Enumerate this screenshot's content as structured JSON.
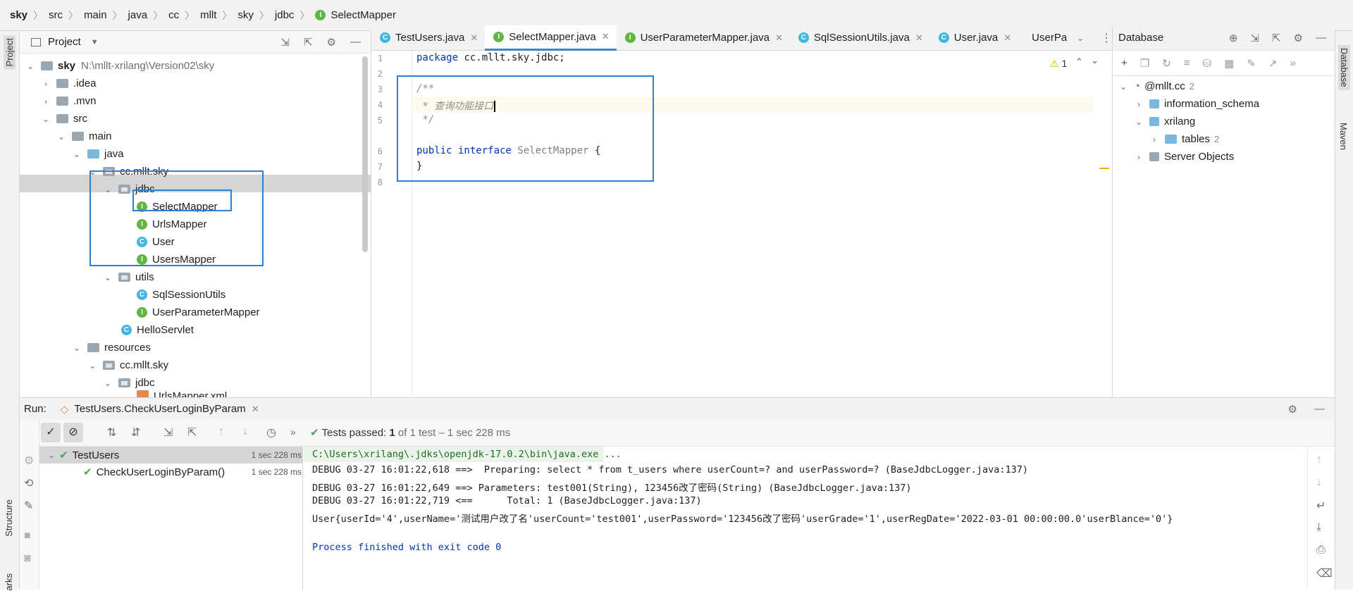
{
  "breadcrumb": [
    "sky",
    "src",
    "main",
    "java",
    "cc",
    "mllt",
    "sky",
    "jdbc",
    "SelectMapper"
  ],
  "project": {
    "title": "Project",
    "root": {
      "name": "sky",
      "path": "N:\\mllt-xrilang\\Version02\\sky"
    },
    "items": [
      ".idea",
      ".mvn",
      "src",
      "main",
      "java",
      "cc.mllt.sky",
      "jdbc",
      "SelectMapper",
      "UrlsMapper",
      "User",
      "UsersMapper",
      "utils",
      "SqlSessionUtils",
      "UserParameterMapper",
      "HelloServlet",
      "resources",
      "cc.mllt.sky",
      "jdbc",
      "UrlsMapper.xml"
    ]
  },
  "editor": {
    "tabs": [
      "TestUsers.java",
      "SelectMapper.java",
      "UserParameterMapper.java",
      "SqlSessionUtils.java",
      "User.java",
      "UserParame"
    ],
    "line_numbers": [
      "1",
      "2",
      "3",
      "4",
      "5",
      "6",
      "7",
      "8"
    ],
    "lines": [
      "package cc.mllt.sky.jdbc;",
      "",
      "/**",
      " * 查询功能接口",
      " */",
      "public interface SelectMapper {",
      "}",
      ""
    ],
    "warning_count": "1"
  },
  "database": {
    "title": "Database",
    "connection": "@mllt.cc",
    "connection_count": "2",
    "schemas": [
      "information_schema",
      "xrilang"
    ],
    "tables_label": "tables",
    "tables_count": "2",
    "server_objects": "Server Objects"
  },
  "run": {
    "label": "Run:",
    "config": "TestUsers.CheckUserLoginByParam",
    "status_prefix": "Tests passed:",
    "status_count": "1",
    "status_suffix": "of 1 test – 1 sec 228 ms",
    "tree": [
      {
        "name": "TestUsers",
        "time": "1 sec 228 ms"
      },
      {
        "name": "CheckUserLoginByParam()",
        "time": "1 sec 228 ms"
      }
    ],
    "console": [
      "C:\\Users\\xrilang\\.jdks\\openjdk-17.0.2\\bin\\java.exe ...",
      "DEBUG 03-27 16:01:22,618 ==>  Preparing: select * from t_users where userCount=? and userPassword=? (BaseJdbcLogger.java:137)",
      "DEBUG 03-27 16:01:22,649 ==> Parameters: test001(String), 123456改了密码(String) (BaseJdbcLogger.java:137)",
      "DEBUG 03-27 16:01:22,719 <==      Total: 1 (BaseJdbcLogger.java:137)",
      "User{userId='4',userName='测试用户改了名'userCount='test001',userPassword='123456改了密码'userGrade='1',userRegDate='2022-03-01 00:00:00.0'userBlance='0'}",
      "",
      "Process finished with exit code 0"
    ]
  },
  "side": {
    "project": "Project",
    "structure": "Structure",
    "bookmarks": "arks",
    "database": "Database",
    "maven": "Maven"
  }
}
